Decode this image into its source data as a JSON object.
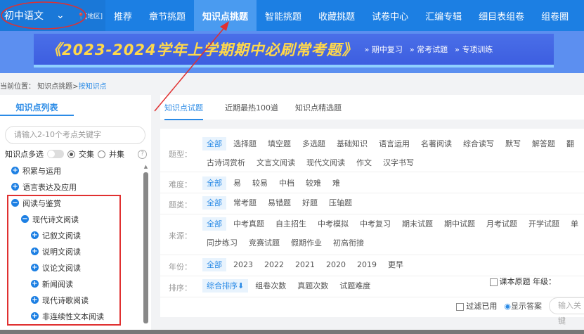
{
  "nav": {
    "subject": "初中语文",
    "region": "[地区]",
    "items": [
      "推荐",
      "章节挑题",
      "知识点挑题",
      "智能挑题",
      "收藏挑题",
      "试卷中心",
      "汇编专辑",
      "细目表组卷",
      "组卷圈"
    ],
    "active": 2
  },
  "banner": {
    "title": "《2023-2024学年上学期期中必刷常考题》",
    "links": [
      "期中复习",
      "常考试题",
      "专项训练"
    ]
  },
  "breadcrumb": {
    "label": "当前位置：",
    "path": "知识点挑题>",
    "current": "按知识点"
  },
  "left": {
    "tab": "知识点列表",
    "search_placeholder": "请输入2-10个考点关键字",
    "multi": "知识点多选",
    "intersect": "交集",
    "union": "并集",
    "help": "?",
    "tree": [
      {
        "label": "积累与运用",
        "level": 0,
        "icon": "+"
      },
      {
        "label": "语言表达及应用",
        "level": 0,
        "icon": "+"
      },
      {
        "label": "阅读与鉴赏",
        "level": 0,
        "icon": "−"
      },
      {
        "label": "现代诗文阅读",
        "level": 1,
        "icon": "−"
      },
      {
        "label": "记叙文阅读",
        "level": 2,
        "icon": "+"
      },
      {
        "label": "说明文阅读",
        "level": 2,
        "icon": "+"
      },
      {
        "label": "议论文阅读",
        "level": 2,
        "icon": "+"
      },
      {
        "label": "新闻阅读",
        "level": 2,
        "icon": "+"
      },
      {
        "label": "现代诗歌阅读",
        "level": 2,
        "icon": "+"
      },
      {
        "label": "非连续性文本阅读",
        "level": 2,
        "icon": "+"
      }
    ]
  },
  "right": {
    "tabs": [
      "知识点试题",
      "近期最热100道",
      "知识点精选题"
    ]
  },
  "filters": [
    {
      "label": "题型：",
      "options": [
        "全部",
        "选择题",
        "填空题",
        "多选题",
        "基础知识",
        "语言运用",
        "名著阅读",
        "综合读写",
        "默写",
        "解答题",
        "翻",
        "古诗词赏析",
        "文言文阅读",
        "现代文阅读",
        "作文",
        "汉字书写"
      ]
    },
    {
      "label": "难度：",
      "options": [
        "全部",
        "易",
        "较易",
        "中档",
        "较难",
        "难"
      ]
    },
    {
      "label": "题类：",
      "options": [
        "全部",
        "常考题",
        "易错题",
        "好题",
        "压轴题"
      ]
    },
    {
      "label": "来源：",
      "options": [
        "全部",
        "中考真题",
        "自主招生",
        "中考模拟",
        "中考复习",
        "期末试题",
        "期中试题",
        "月考试题",
        "开学试题",
        "单",
        "同步练习",
        "竞赛试题",
        "假期作业",
        "初高衔接"
      ]
    },
    {
      "label": "年份：",
      "options": [
        "全部",
        "2023",
        "2022",
        "2021",
        "2020",
        "2019",
        "更早"
      ]
    },
    {
      "label": "排序：",
      "options": [
        "综合排序⬇",
        "组卷次数",
        "真题次数",
        "试题难度"
      ]
    }
  ],
  "extra": {
    "textbook": "课本原题",
    "grade": "年级：",
    "filter_used": "过滤已用",
    "show_answer": "显示答案",
    "keyword_placeholder": "输入关键"
  },
  "colors": {
    "nav": "#1c7fe3",
    "accent": "#2b8be6",
    "annotation": "#e03030"
  }
}
